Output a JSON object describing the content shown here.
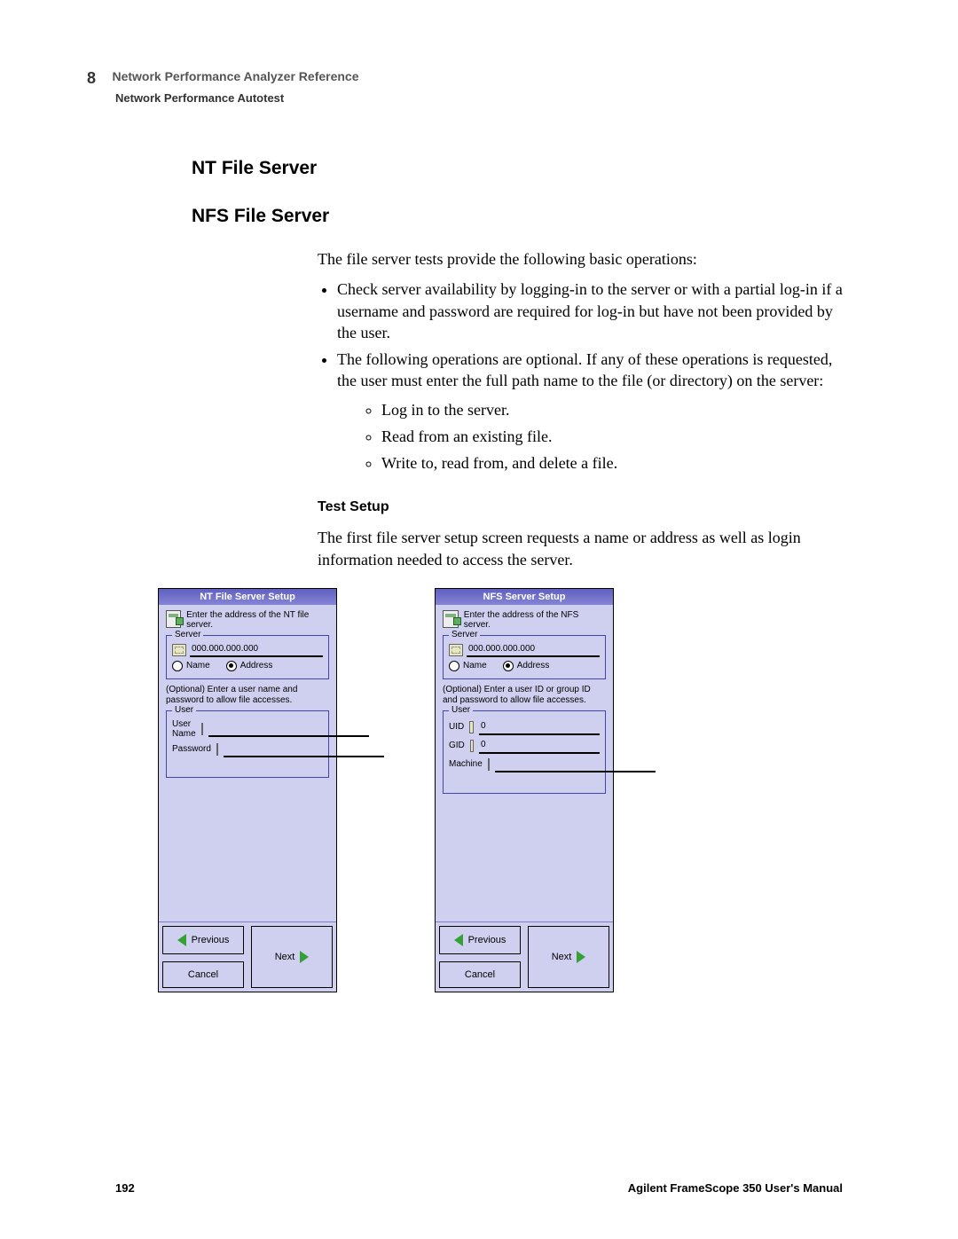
{
  "header": {
    "chapter_number": "8",
    "running_head_main": "Network Performance Analyzer Reference",
    "running_head_sub": "Network Performance Autotest"
  },
  "h_nt": "NT File Server",
  "h_nfs": "NFS File Server",
  "intro": "The file server tests provide the following basic operations:",
  "bullets": {
    "b1": "Check server availability by logging-in to the server or with a partial log-in if a username and password are required for log-in but have not been provided by the user.",
    "b2": "The following operations are optional. If any of these operations is requested, the user must enter the full path name to the file (or directory) on the server:",
    "b2a": "Log in to the server.",
    "b2b": "Read from an existing file.",
    "b2c": "Write to, read from, and delete a file."
  },
  "h_testsetup": "Test Setup",
  "testsetup_text": "The first file server setup screen requests a name or address as well as login information needed to access the server.",
  "dlg_nt": {
    "title": "NT File Server Setup",
    "instr": "Enter the address of the NT file server.",
    "server_legend": "Server",
    "server_value": "000.000.000.000",
    "radio_name": "Name",
    "radio_addr": "Address",
    "opt_note": "(Optional) Enter a user name and password to allow file accesses.",
    "user_legend": "User",
    "lbl_username": "User Name",
    "lbl_password": "Password",
    "btn_prev": "Previous",
    "btn_cancel": "Cancel",
    "btn_next": "Next"
  },
  "dlg_nfs": {
    "title": "NFS Server Setup",
    "instr": "Enter the address of the NFS server.",
    "server_legend": "Server",
    "server_value": "000.000.000.000",
    "radio_name": "Name",
    "radio_addr": "Address",
    "opt_note": "(Optional) Enter a user ID or group ID and password to allow file accesses.",
    "user_legend": "User",
    "lbl_uid": "UID",
    "val_uid": "0",
    "lbl_gid": "GID",
    "val_gid": "0",
    "lbl_machine": "Machine",
    "btn_prev": "Previous",
    "btn_cancel": "Cancel",
    "btn_next": "Next"
  },
  "footer": {
    "page": "192",
    "manual": "Agilent FrameScope 350 User's Manual"
  }
}
